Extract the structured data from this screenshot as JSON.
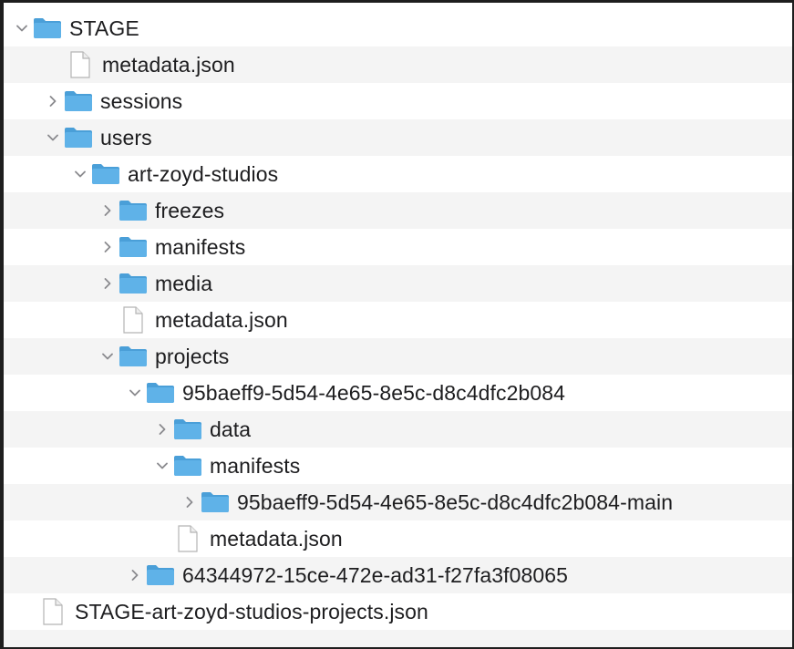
{
  "tree": [
    {
      "label": "STAGE",
      "type": "folder",
      "state": "expanded"
    },
    {
      "label": "metadata.json",
      "type": "file"
    },
    {
      "label": "sessions",
      "type": "folder",
      "state": "collapsed"
    },
    {
      "label": "users",
      "type": "folder",
      "state": "expanded"
    },
    {
      "label": "art-zoyd-studios",
      "type": "folder",
      "state": "expanded"
    },
    {
      "label": "freezes",
      "type": "folder",
      "state": "collapsed"
    },
    {
      "label": "manifests",
      "type": "folder",
      "state": "collapsed"
    },
    {
      "label": "media",
      "type": "folder",
      "state": "collapsed"
    },
    {
      "label": "metadata.json",
      "type": "file"
    },
    {
      "label": "projects",
      "type": "folder",
      "state": "expanded"
    },
    {
      "label": "95baeff9-5d54-4e65-8e5c-d8c4dfc2b084",
      "type": "folder",
      "state": "expanded"
    },
    {
      "label": "data",
      "type": "folder",
      "state": "collapsed"
    },
    {
      "label": "manifests",
      "type": "folder",
      "state": "expanded"
    },
    {
      "label": "95baeff9-5d54-4e65-8e5c-d8c4dfc2b084-main",
      "type": "folder",
      "state": "collapsed"
    },
    {
      "label": "metadata.json",
      "type": "file"
    },
    {
      "label": "64344972-15ce-472e-ad31-f27fa3f08065",
      "type": "folder",
      "state": "collapsed"
    },
    {
      "label": "STAGE-art-zoyd-studios-projects.json",
      "type": "file"
    }
  ],
  "colors": {
    "folder_body": "#5fb2e8",
    "folder_tab": "#4a9fd8",
    "chevron": "#8a8a8e",
    "stripe": "#f4f4f4"
  }
}
